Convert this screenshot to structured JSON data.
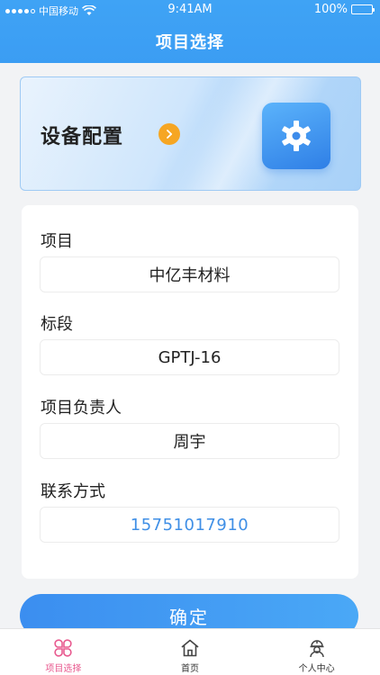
{
  "status_bar": {
    "carrier": "中国移动",
    "time": "9:41AM",
    "battery": "100%"
  },
  "header": {
    "title": "项目选择"
  },
  "banner": {
    "title": "设备配置",
    "arrow_icon": "chevron-right-icon",
    "tile_icon": "gear-icon"
  },
  "form": {
    "project_label": "项目",
    "project_value": "中亿丰材料",
    "section_label": "标段",
    "section_value": "GPTJ-16",
    "manager_label": "项目负责人",
    "manager_value": "周宇",
    "contact_label": "联系方式",
    "contact_value": "15751017910"
  },
  "confirm_label": "确定",
  "tabbar": {
    "items": [
      {
        "label": "项目选择",
        "icon": "clover-grid-icon",
        "active": true
      },
      {
        "label": "首页",
        "icon": "home-icon",
        "active": false
      },
      {
        "label": "个人中心",
        "icon": "worker-helmet-icon",
        "active": false
      }
    ]
  },
  "colors": {
    "primary": "#3b9df3",
    "accent_orange": "#f6a623",
    "tab_active": "#e85a8f",
    "phone_link": "#3f8fe6"
  }
}
